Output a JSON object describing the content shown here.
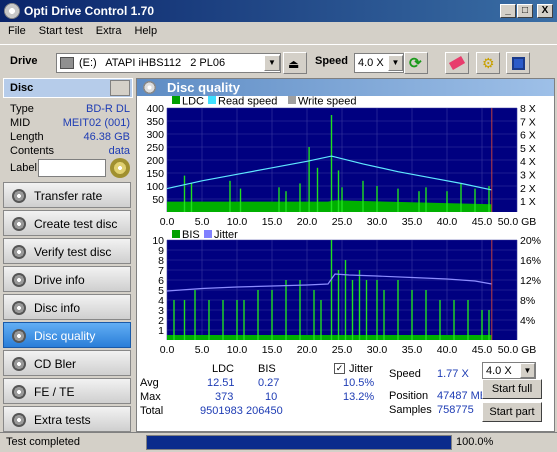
{
  "window": {
    "title": "Opti Drive Control 1.70",
    "controls": [
      "_",
      "□",
      "X"
    ]
  },
  "menu": [
    "File",
    "Start test",
    "Extra",
    "Help"
  ],
  "toolbar": {
    "drive_label": "Drive",
    "drive_value": "(E:)   ATAPI iHBS112   2 PL06",
    "speed_label": "Speed",
    "speed_value": "4.0 X"
  },
  "disc": {
    "header": "Disc",
    "type_k": "Type",
    "type_v": "BD-R DL",
    "mid_k": "MID",
    "mid_v": "MEIT02 (001)",
    "length_k": "Length",
    "length_v": "46.38 GB",
    "contents_k": "Contents",
    "contents_v": "data",
    "label_k": "Label"
  },
  "nav": [
    "Transfer rate",
    "Create test disc",
    "Verify test disc",
    "Drive info",
    "Disc info",
    "Disc quality",
    "CD Bler",
    "FE / TE",
    "Extra tests"
  ],
  "nav_selected": 5,
  "panel": {
    "title": "Disc quality"
  },
  "chart_data": [
    {
      "type": "bar",
      "legend": [
        "LDC",
        "Read speed",
        "Write speed"
      ],
      "legend_colors": [
        "#00a000",
        "#40e0ff",
        "#a0a0a0"
      ],
      "xlim": [
        0,
        50
      ],
      "x_unit": "GB",
      "x_ticks": [
        "0.0",
        "5.0",
        "10.0",
        "15.0",
        "20.0",
        "25.0",
        "30.0",
        "35.0",
        "40.0",
        "45.0",
        "50.0 GB"
      ],
      "ylim": [
        0,
        400
      ],
      "y_ticks": [
        "400",
        "350",
        "300",
        "250",
        "200",
        "150",
        "100",
        "50"
      ],
      "y2_ticks": [
        "8 X",
        "7 X",
        "6 X",
        "5 X",
        "4 X",
        "3 X",
        "2 X",
        "1 X"
      ],
      "ldc_base": [
        [
          0,
          40
        ],
        [
          23,
          40
        ],
        [
          24,
          45
        ],
        [
          46.4,
          30
        ]
      ],
      "ldc_spikes": [
        [
          2.5,
          140
        ],
        [
          3.5,
          110
        ],
        [
          9,
          120
        ],
        [
          10.5,
          90
        ],
        [
          16,
          95
        ],
        [
          17,
          80
        ],
        [
          19,
          110
        ],
        [
          20.3,
          250
        ],
        [
          21.5,
          170
        ],
        [
          23.5,
          373
        ],
        [
          24.5,
          160
        ],
        [
          25,
          95
        ],
        [
          28,
          120
        ],
        [
          30,
          100
        ],
        [
          33,
          90
        ],
        [
          36,
          80
        ],
        [
          37,
          95
        ],
        [
          40,
          80
        ],
        [
          42,
          110
        ],
        [
          44,
          90
        ],
        [
          46,
          100
        ]
      ],
      "read_speed": [
        [
          0,
          1.8
        ],
        [
          5,
          2.4
        ],
        [
          10,
          2.9
        ],
        [
          15,
          3.4
        ],
        [
          20,
          3.9
        ],
        [
          23.5,
          4.3
        ],
        [
          28,
          3.7
        ],
        [
          33,
          3.1
        ],
        [
          38,
          2.6
        ],
        [
          42,
          2.2
        ],
        [
          46.4,
          1.7
        ]
      ]
    },
    {
      "type": "bar",
      "legend": [
        "BIS",
        "Jitter"
      ],
      "legend_colors": [
        "#00a000",
        "#8080ff"
      ],
      "xlim": [
        0,
        50
      ],
      "x_ticks": [
        "0.0",
        "5.0",
        "10.0",
        "15.0",
        "20.0",
        "25.0",
        "30.0",
        "35.0",
        "40.0",
        "45.0",
        "50.0 GB"
      ],
      "ylim": [
        0,
        10
      ],
      "y_ticks": [
        "10",
        "9",
        "8",
        "7",
        "6",
        "5",
        "4",
        "3",
        "2",
        "1"
      ],
      "y2_ticks": [
        "20%",
        "16%",
        "12%",
        "8%",
        "4%"
      ],
      "bis_spikes": [
        [
          1,
          4
        ],
        [
          2.5,
          4
        ],
        [
          4,
          5
        ],
        [
          6,
          4
        ],
        [
          8,
          4
        ],
        [
          10,
          4
        ],
        [
          11,
          4
        ],
        [
          13,
          5
        ],
        [
          15,
          5
        ],
        [
          17,
          6
        ],
        [
          19,
          6
        ],
        [
          21,
          5
        ],
        [
          22,
          4
        ],
        [
          23.5,
          10
        ],
        [
          24.5,
          7
        ],
        [
          25.5,
          8
        ],
        [
          26.5,
          6
        ],
        [
          27.5,
          7
        ],
        [
          28.5,
          6
        ],
        [
          30,
          6
        ],
        [
          31,
          5
        ],
        [
          33,
          6
        ],
        [
          35,
          5
        ],
        [
          37,
          5
        ],
        [
          39,
          4
        ],
        [
          41,
          4
        ],
        [
          43,
          4
        ],
        [
          45,
          3
        ],
        [
          46,
          3
        ]
      ],
      "jitter": [
        [
          0,
          9.8
        ],
        [
          5,
          10.3
        ],
        [
          10,
          10.6
        ],
        [
          15,
          10.8
        ],
        [
          20,
          11.0
        ],
        [
          23,
          11.2
        ],
        [
          24,
          13.2
        ],
        [
          26,
          13.0
        ],
        [
          30,
          12.8
        ],
        [
          35,
          12.5
        ],
        [
          40,
          12.2
        ],
        [
          44,
          11.8
        ],
        [
          46.4,
          11.2
        ]
      ]
    }
  ],
  "stats": {
    "h_ldc": "LDC",
    "h_bis": "BIS",
    "avg_k": "Avg",
    "avg_ldc": "12.51",
    "avg_bis": "0.27",
    "max_k": "Max",
    "max_ldc": "373",
    "max_bis": "10",
    "total_k": "Total",
    "total_ldc": "9501983",
    "total_bis": "206450",
    "jitter_label": "Jitter",
    "jitter_avg": "10.5%",
    "jitter_max": "13.2%",
    "speed_k": "Speed",
    "speed_v": "1.77 X",
    "speed_select": "4.0 X",
    "position_k": "Position",
    "position_v": "47487 MB",
    "samples_k": "Samples",
    "samples_v": "758775",
    "start_full": "Start full",
    "start_part": "Start part"
  },
  "status": {
    "text": "Test completed",
    "progress_text": "100.0%",
    "progress": 1.0
  }
}
